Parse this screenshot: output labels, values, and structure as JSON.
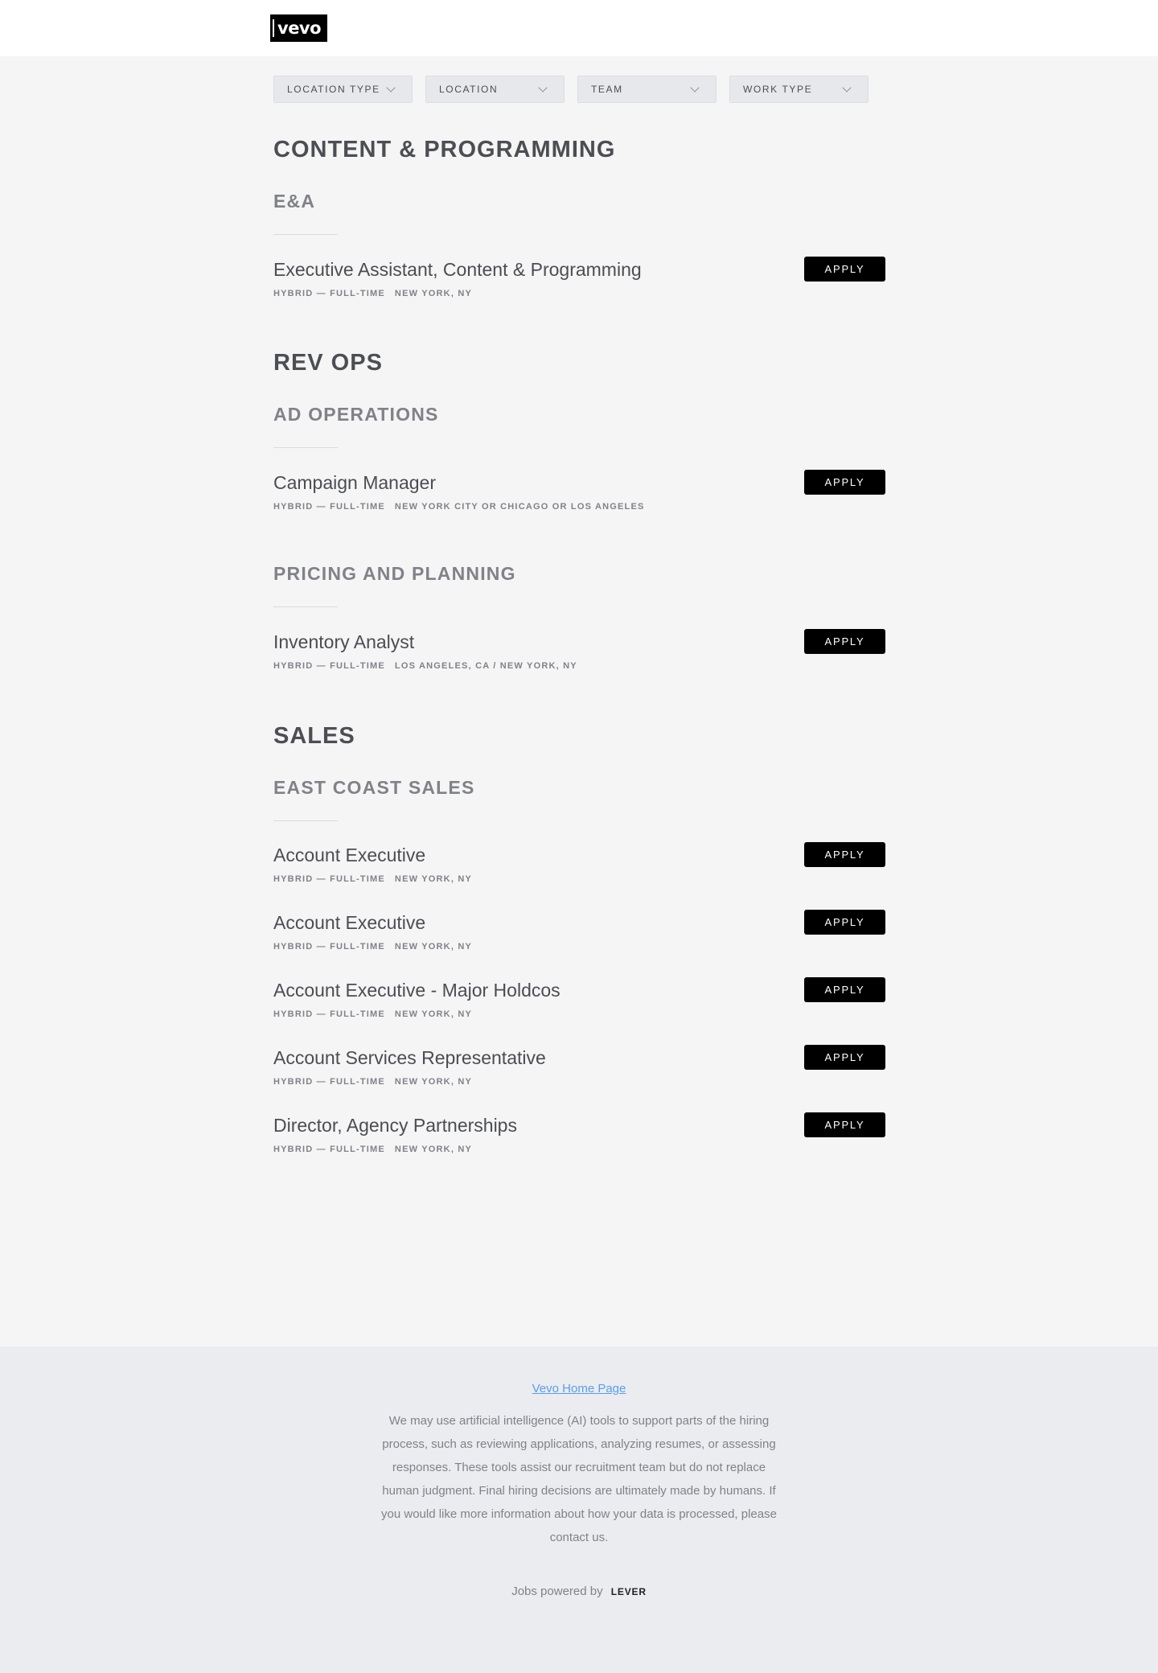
{
  "header": {
    "logo_text": "vevo"
  },
  "filters": [
    {
      "label": "LOCATION TYPE"
    },
    {
      "label": "LOCATION"
    },
    {
      "label": "TEAM"
    },
    {
      "label": "WORK TYPE"
    }
  ],
  "apply_label": "APPLY",
  "groups": [
    {
      "title": "CONTENT & PROGRAMMING",
      "teams": [
        {
          "title": "E&A",
          "postings": [
            {
              "title": "Executive Assistant, Content & Programming",
              "commitment": "HYBRID — FULL-TIME",
              "location": "NEW YORK, NY"
            }
          ]
        }
      ]
    },
    {
      "title": "REV OPS",
      "teams": [
        {
          "title": "AD OPERATIONS",
          "postings": [
            {
              "title": "Campaign Manager",
              "commitment": "HYBRID — FULL-TIME",
              "location": "NEW YORK CITY OR CHICAGO OR LOS ANGELES"
            }
          ]
        },
        {
          "title": "PRICING AND PLANNING",
          "postings": [
            {
              "title": "Inventory Analyst",
              "commitment": "HYBRID — FULL-TIME",
              "location": "LOS ANGELES, CA / NEW YORK, NY"
            }
          ]
        }
      ]
    },
    {
      "title": "SALES",
      "teams": [
        {
          "title": "EAST COAST SALES",
          "postings": [
            {
              "title": "Account Executive",
              "commitment": "HYBRID — FULL-TIME",
              "location": "NEW YORK, NY"
            },
            {
              "title": "Account Executive",
              "commitment": "HYBRID — FULL-TIME",
              "location": "NEW YORK, NY"
            },
            {
              "title": "Account Executive - Major Holdcos",
              "commitment": "HYBRID — FULL-TIME",
              "location": "NEW YORK, NY"
            },
            {
              "title": "Account Services Representative",
              "commitment": "HYBRID — FULL-TIME",
              "location": "NEW YORK, NY"
            },
            {
              "title": "Director, Agency Partnerships",
              "commitment": "HYBRID — FULL-TIME",
              "location": "NEW YORK, NY"
            }
          ]
        }
      ]
    }
  ],
  "footer": {
    "home_link": "Vevo Home Page",
    "disclaimer": "We may use artificial intelligence (AI) tools to support parts of the hiring process, such as reviewing applications, analyzing resumes, or assessing responses. These tools assist our recruitment team but do not replace human judgment. Final hiring decisions are ultimately made by humans. If you would like more information about how your data is processed, please contact us.",
    "powered_by": "Jobs powered by",
    "powered_brand": "LEVER"
  }
}
